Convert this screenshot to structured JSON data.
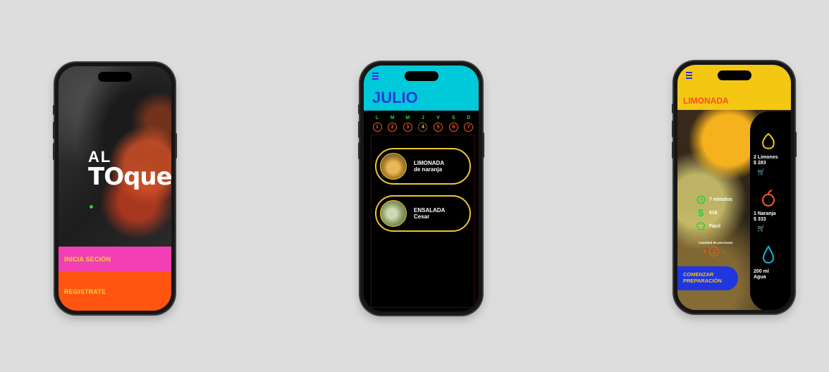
{
  "screen1": {
    "logo_top": "AL",
    "logo_bottom": "TOque",
    "login_label": "INICIA SECIÓN",
    "register_label": "REGISTRATE"
  },
  "screen2": {
    "month": "JULIO",
    "days": [
      {
        "letter": "L",
        "number": "1"
      },
      {
        "letter": "M",
        "number": "2"
      },
      {
        "letter": "M",
        "number": "3"
      },
      {
        "letter": "J",
        "number": "4"
      },
      {
        "letter": "V",
        "number": "5"
      },
      {
        "letter": "S",
        "number": "6"
      },
      {
        "letter": "D",
        "number": "7"
      }
    ],
    "selected_day": "4",
    "recipes": [
      {
        "line1": "LIMONADA",
        "line2": "de naranja"
      },
      {
        "line1": "ENSALADA",
        "line2": "Cesar"
      }
    ]
  },
  "screen3": {
    "title": "LIMONADA",
    "ingredients": [
      {
        "name": "2 Limones",
        "price": "$ 283",
        "icon": "lemon-icon"
      },
      {
        "name": "1 Naranja",
        "price": "$ 333",
        "icon": "orange-icon"
      },
      {
        "name": "200 ml",
        "price": "Agua",
        "icon": "water-drop-icon"
      }
    ],
    "time": "7 minutos",
    "cost": "616",
    "difficulty": "Fácil",
    "portions_label": "Cantidad de porciones",
    "portions": "2",
    "plus": "+",
    "minus": "-",
    "start_label": "COMENZAR PREPARACIÓN"
  },
  "colors": {
    "background": "#dddddd",
    "pink": "#f23fb3",
    "orange": "#ff5511",
    "cyan": "#00c9d9",
    "blue": "#2a3ad8",
    "yellow": "#f4c713",
    "green": "#2fcf3a"
  }
}
